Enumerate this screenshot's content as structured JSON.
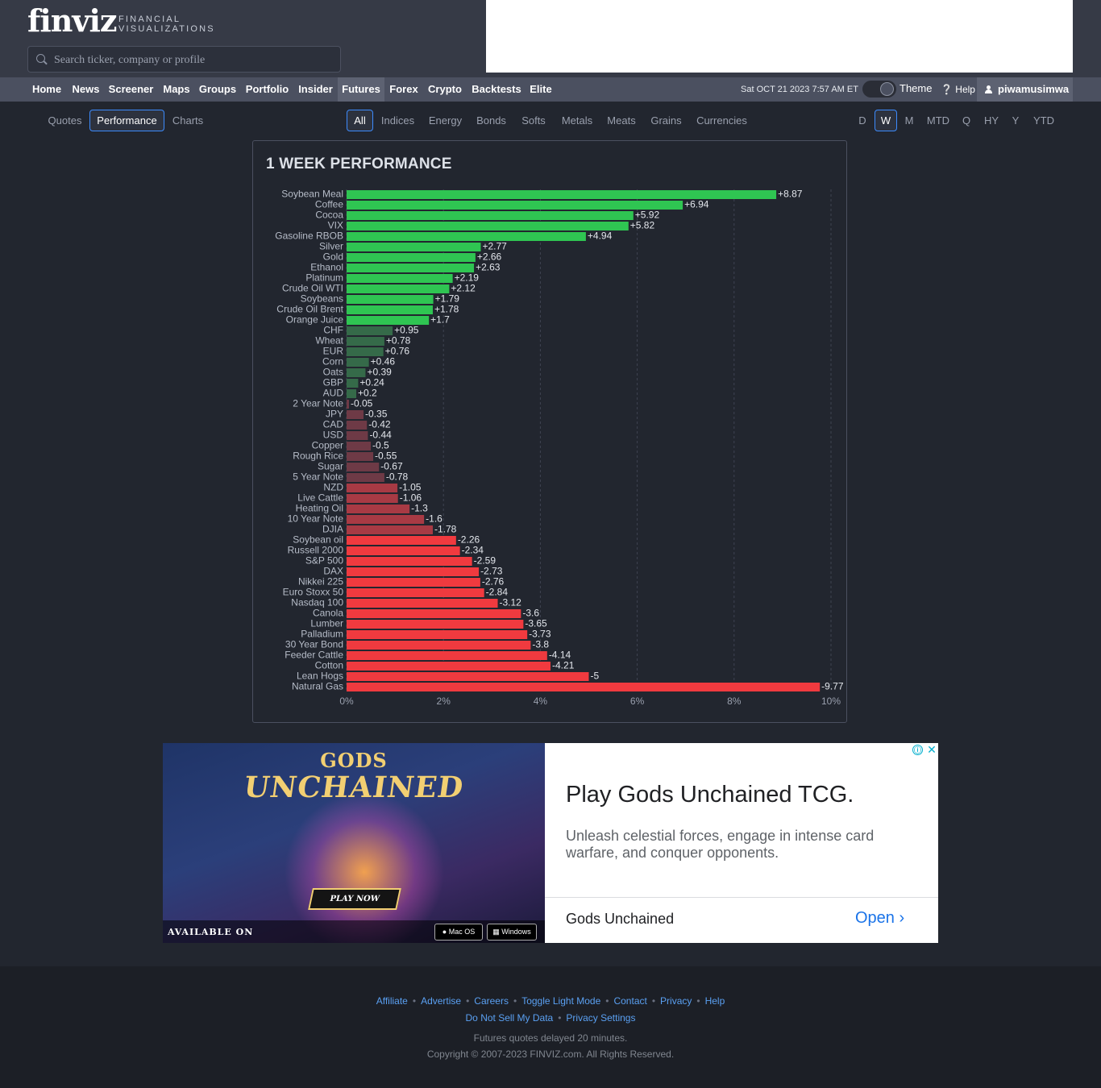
{
  "header": {
    "logo_text": "finviz",
    "logo_sub_1": "FINANCIAL",
    "logo_sub_2": "VISUALIZATIONS",
    "search_placeholder": "Search ticker, company or profile"
  },
  "nav": {
    "items": [
      "Home",
      "News",
      "Screener",
      "Maps",
      "Groups",
      "Portfolio",
      "Insider",
      "Futures",
      "Forex",
      "Crypto",
      "Backtests",
      "Elite"
    ],
    "active": "Futures",
    "datetime": "Sat OCT 21 2023 7:57 AM ET",
    "theme_label": "Theme",
    "help_label": "Help",
    "username": "piwamusimwa"
  },
  "view_tabs": {
    "items": [
      "Quotes",
      "Performance",
      "Charts"
    ],
    "selected": "Performance"
  },
  "group_tabs": {
    "items": [
      "All",
      "Indices",
      "Energy",
      "Bonds",
      "Softs",
      "Metals",
      "Meats",
      "Grains",
      "Currencies"
    ],
    "selected": "All"
  },
  "period_tabs": {
    "items": [
      "D",
      "W",
      "M",
      "MTD",
      "Q",
      "HY",
      "Y",
      "YTD"
    ],
    "selected": "W"
  },
  "chart_title": "1 WEEK PERFORMANCE",
  "chart_data": {
    "type": "bar",
    "orientation": "horizontal",
    "title": "1 WEEK PERFORMANCE",
    "categories": [
      "Soybean Meal",
      "Coffee",
      "Cocoa",
      "VIX",
      "Gasoline RBOB",
      "Silver",
      "Gold",
      "Ethanol",
      "Platinum",
      "Crude Oil WTI",
      "Soybeans",
      "Crude Oil Brent",
      "Orange Juice",
      "CHF",
      "Wheat",
      "EUR",
      "Corn",
      "Oats",
      "GBP",
      "AUD",
      "2 Year Note",
      "JPY",
      "CAD",
      "USD",
      "Copper",
      "Rough Rice",
      "Sugar",
      "5 Year Note",
      "NZD",
      "Live Cattle",
      "Heating Oil",
      "10 Year Note",
      "DJIA",
      "Soybean oil",
      "Russell 2000",
      "S&P 500",
      "DAX",
      "Nikkei 225",
      "Euro Stoxx 50",
      "Nasdaq 100",
      "Canola",
      "Lumber",
      "Palladium",
      "30 Year Bond",
      "Feeder Cattle",
      "Cotton",
      "Lean Hogs",
      "Natural Gas"
    ],
    "values": [
      8.87,
      6.94,
      5.92,
      5.82,
      4.94,
      2.77,
      2.66,
      2.63,
      2.19,
      2.12,
      1.79,
      1.78,
      1.7,
      0.95,
      0.78,
      0.76,
      0.46,
      0.39,
      0.24,
      0.2,
      -0.05,
      -0.35,
      -0.42,
      -0.44,
      -0.5,
      -0.55,
      -0.67,
      -0.78,
      -1.05,
      -1.06,
      -1.3,
      -1.6,
      -1.78,
      -2.26,
      -2.34,
      -2.59,
      -2.73,
      -2.76,
      -2.84,
      -3.12,
      -3.6,
      -3.65,
      -3.73,
      -3.8,
      -4.14,
      -4.21,
      -5,
      -9.77
    ],
    "value_labels": [
      "+8.87",
      "+6.94",
      "+5.92",
      "+5.82",
      "+4.94",
      "+2.77",
      "+2.66",
      "+2.63",
      "+2.19",
      "+2.12",
      "+1.79",
      "+1.78",
      "+1.7",
      "+0.95",
      "+0.78",
      "+0.76",
      "+0.46",
      "+0.39",
      "+0.24",
      "+0.2",
      "-0.05",
      "-0.35",
      "-0.42",
      "-0.44",
      "-0.5",
      "-0.55",
      "-0.67",
      "-0.78",
      "-1.05",
      "-1.06",
      "-1.3",
      "-1.6",
      "-1.78",
      "-2.26",
      "-2.34",
      "-2.59",
      "-2.73",
      "-2.76",
      "-2.84",
      "-3.12",
      "-3.6",
      "-3.65",
      "-3.73",
      "-3.8",
      "-4.14",
      "-4.21",
      "-5",
      "-9.77"
    ],
    "bar_length": "absolute value",
    "xlim": [
      0,
      10
    ],
    "xticks": [
      "0%",
      "2%",
      "4%",
      "6%",
      "8%",
      "10%"
    ],
    "grid": "vertical dashed",
    "colors": {
      "pos_strong": "#2fc552",
      "pos_mid": "#2a9e48",
      "pos_weak": "#356a49",
      "neg_weak": "#6e3a46",
      "neg_mid": "#a83a44",
      "neg_strong": "#f03a3f"
    }
  },
  "ad": {
    "game_logo_1": "GODS",
    "game_logo_2": "UNCHAINED",
    "play_now": "PLAY NOW",
    "available_on": "AVAILABLE ON",
    "macos": "Mac OS",
    "windows": "Windows",
    "headline": "Play Gods Unchained TCG.",
    "body": "Unleash celestial forces, engage in intense card warfare, and conquer opponents.",
    "brand": "Gods Unchained",
    "cta": "Open",
    "info_icon": "ⓘ",
    "close_icon": "✕"
  },
  "footer": {
    "links_row1": [
      "Affiliate",
      "Advertise",
      "Careers",
      "Toggle Light Mode",
      "Contact",
      "Privacy",
      "Help"
    ],
    "links_row2": [
      "Do Not Sell My Data",
      "Privacy Settings"
    ],
    "delay_note": "Futures quotes delayed 20 minutes.",
    "copyright": "Copyright © 2007-2023 FINVIZ.com. All Rights Reserved."
  }
}
